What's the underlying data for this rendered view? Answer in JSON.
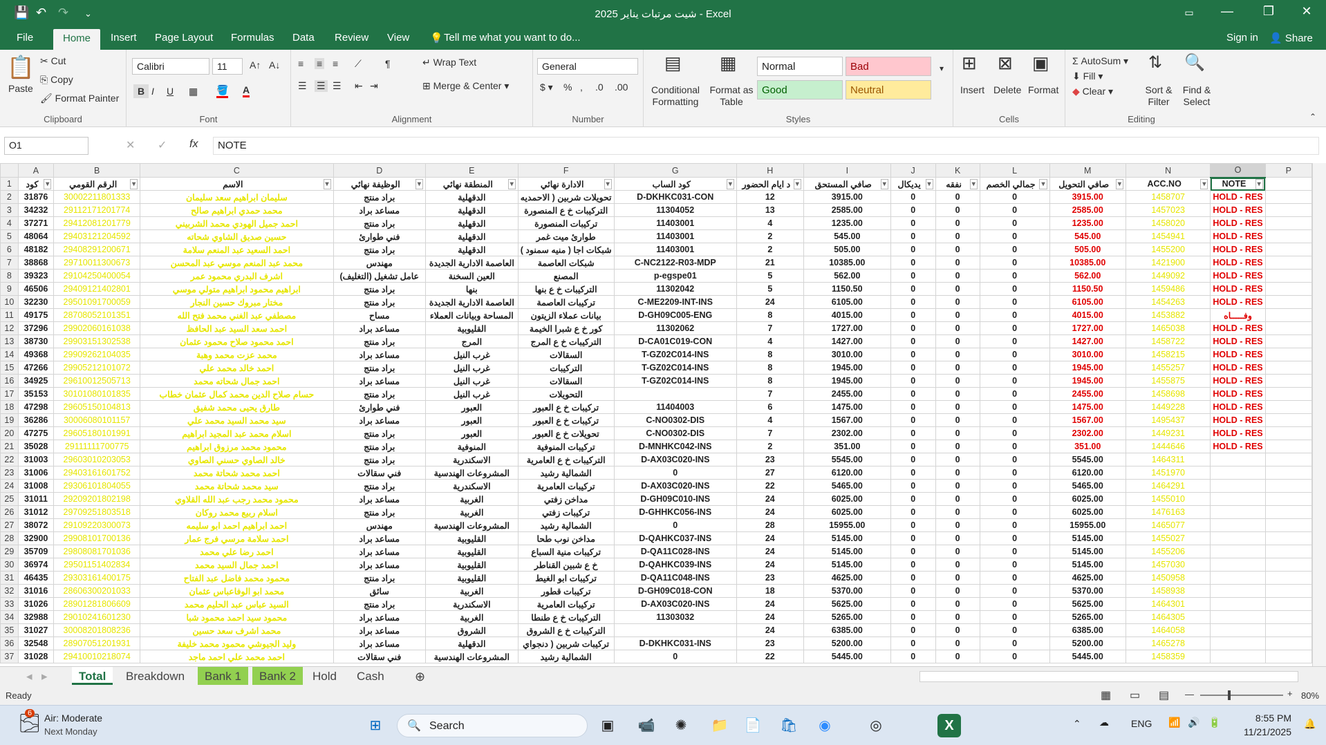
{
  "title": "شيت مرتبات يناير 2025 - Excel",
  "menu": {
    "file": "File",
    "tabs": [
      "Home",
      "Insert",
      "Page Layout",
      "Formulas",
      "Data",
      "Review",
      "View"
    ],
    "tell": "Tell me what you want to do...",
    "signin": "Sign in",
    "share": "Share"
  },
  "ribbon": {
    "clipboard": {
      "paste": "Paste",
      "cut": "Cut",
      "copy": "Copy",
      "painter": "Format Painter",
      "label": "Clipboard"
    },
    "font": {
      "name": "Calibri",
      "size": "11",
      "label": "Font"
    },
    "alignment": {
      "wrap": "Wrap Text",
      "merge": "Merge & Center",
      "label": "Alignment"
    },
    "number": {
      "format": "General",
      "label": "Number"
    },
    "styles": {
      "cond": "Conditional Formatting",
      "table": "Format as Table",
      "normal": "Normal",
      "bad": "Bad",
      "good": "Good",
      "neutral": "Neutral",
      "label": "Styles"
    },
    "cells": {
      "insert": "Insert",
      "delete": "Delete",
      "format": "Format",
      "label": "Cells"
    },
    "editing": {
      "autosum": "AutoSum",
      "fill": "Fill",
      "clear": "Clear",
      "sort": "Sort & Filter",
      "find": "Find & Select",
      "label": "Editing"
    }
  },
  "formula": {
    "namebox": "O1",
    "fx": "fx",
    "value": "NOTE"
  },
  "columns": [
    "A",
    "B",
    "C",
    "D",
    "E",
    "F",
    "G",
    "H",
    "I",
    "J",
    "K",
    "L",
    "M",
    "N",
    "O",
    "P"
  ],
  "headers": [
    "كود",
    "الرقم القومي",
    "الاسم",
    "الوظيفة نهائي",
    "المنطقة نهائي",
    "الادارة نهائي",
    "كود الساب",
    "د ايام الحضور",
    "صافي المستحق",
    "يديكال",
    "نفقه",
    "جمالي الخصم",
    "صافي التحويل",
    "ACC.NO",
    "NOTE"
  ],
  "rows": [
    [
      "31876",
      "30002211801333",
      "سليمان ابراهيم سعد سليمان",
      "براد منتج",
      "الدقهلية",
      "تحويلات شربين ( الاحمديه",
      "D-DKHKC031-CON",
      "12",
      "3915.00",
      "0",
      "0",
      "0",
      "3915.00",
      "1458707",
      "HOLD - RES"
    ],
    [
      "34232",
      "29112171201774",
      "محمد حمدي ابراهيم صالح",
      "مساعد براد",
      "الدقهلية",
      "التركيبات خ ع المنصورة",
      "11304052",
      "13",
      "2585.00",
      "0",
      "0",
      "0",
      "2585.00",
      "1457023",
      "HOLD - RES"
    ],
    [
      "37271",
      "29412081201779",
      "احمد جميل الهودي محمد الشربيني",
      "براد منتج",
      "الدقهلية",
      "تركيبات المنصورة",
      "11403001",
      "4",
      "1235.00",
      "0",
      "0",
      "0",
      "1235.00",
      "1458020",
      "HOLD - RES"
    ],
    [
      "48064",
      "29403121204592",
      "حسين صديق الشاوي شحاته",
      "فني طوارئ",
      "الدقهلية",
      "طوارئ ميت غمر",
      "11403001",
      "2",
      "545.00",
      "0",
      "0",
      "0",
      "545.00",
      "1454941",
      "HOLD - RES"
    ],
    [
      "48182",
      "29408291200671",
      "احمد السعيد عبد المنعم سلامة",
      "براد منتج",
      "الدقهلية",
      "شبكات اجا ( منيه سمنود )",
      "11403001",
      "2",
      "505.00",
      "0",
      "0",
      "0",
      "505.00",
      "1455200",
      "HOLD - RES"
    ],
    [
      "38868",
      "29710011300673",
      "محمد عبد المنعم موسي عبد المحسن",
      "مهندس",
      "العاصمة الادارية الجديدة",
      "شبكات العاصمة",
      "C-NC2122-R03-MDP",
      "21",
      "10385.00",
      "0",
      "0",
      "0",
      "10385.00",
      "1421900",
      "HOLD - RES"
    ],
    [
      "39323",
      "29104250400054",
      "اشرف البدري محمود عمر",
      "عامل تشغيل (التغليف)",
      "العين السخنة",
      "المصنع",
      "p-egspe01",
      "5",
      "562.00",
      "0",
      "0",
      "0",
      "562.00",
      "1449092",
      "HOLD - RES"
    ],
    [
      "46506",
      "29409121402801",
      "ابراهيم محمود ابراهيم متولي موسي",
      "براد منتج",
      "بنها",
      "التركيبات خ ع بنها",
      "11302042",
      "5",
      "1150.50",
      "0",
      "0",
      "0",
      "1150.50",
      "1459486",
      "HOLD - RES"
    ],
    [
      "32230",
      "29501091700059",
      "مختار مبروك حسين النجار",
      "براد منتج",
      "العاصمة الادارية الجديدة",
      "تركيبات العاصمة",
      "C-ME2209-INT-INS",
      "24",
      "6105.00",
      "0",
      "0",
      "0",
      "6105.00",
      "1454263",
      "HOLD - RES"
    ],
    [
      "49175",
      "28708052101351",
      "مصطفي عبد الغني محمد فتح الله",
      "مساح",
      "المساحة وبيانات العملاء",
      "بيانات عملاء الزيتون",
      "D-GH09C005-ENG",
      "8",
      "4015.00",
      "0",
      "0",
      "0",
      "4015.00",
      "1453882",
      "وفـــــاه"
    ],
    [
      "37296",
      "29902060161038",
      "احمد سعد السيد عبد الحافظ",
      "مساعد براد",
      "القليوبية",
      "كور خ ع شبرا الخيمة",
      "11302062",
      "7",
      "1727.00",
      "0",
      "0",
      "0",
      "1727.00",
      "1465038",
      "HOLD - RES"
    ],
    [
      "38730",
      "29903151302538",
      "احمد محمود صلاح محمود عثمان",
      "براد منتج",
      "المرج",
      "التركيبات خ ع المرج",
      "D-CA01C019-CON",
      "4",
      "1427.00",
      "0",
      "0",
      "0",
      "1427.00",
      "1458722",
      "HOLD - RES"
    ],
    [
      "49368",
      "29909262104035",
      "محمد عزت محمد وهبة",
      "مساعد براد",
      "غرب النيل",
      "السقالات",
      "T-GZ02C014-INS",
      "8",
      "3010.00",
      "0",
      "0",
      "0",
      "3010.00",
      "1458215",
      "HOLD - RES"
    ],
    [
      "47266",
      "29905212101072",
      "احمد خالد محمد علي",
      "براد منتج",
      "غرب النيل",
      "التركيبات",
      "T-GZ02C014-INS",
      "8",
      "1945.00",
      "0",
      "0",
      "0",
      "1945.00",
      "1455257",
      "HOLD - RES"
    ],
    [
      "34925",
      "29610012505713",
      "احمد جمال شحاته محمد",
      "مساعد براد",
      "غرب النيل",
      "السقالات",
      "T-GZ02C014-INS",
      "8",
      "1945.00",
      "0",
      "0",
      "0",
      "1945.00",
      "1455875",
      "HOLD - RES"
    ],
    [
      "35153",
      "30101080101835",
      "حسام صلاح الدين محمد كمال عثمان خطاب",
      "براد منتج",
      "غرب النيل",
      "التحويلات",
      "",
      "7",
      "2455.00",
      "0",
      "0",
      "0",
      "2455.00",
      "1458698",
      "HOLD - RES"
    ],
    [
      "47298",
      "29605150104813",
      "طارق يحيى محمد شفيق",
      "فني طوارئ",
      "العبور",
      "تركيبات خ ع العبور",
      "11404003",
      "6",
      "1475.00",
      "0",
      "0",
      "0",
      "1475.00",
      "1449228",
      "HOLD - RES"
    ],
    [
      "36286",
      "30006080101157",
      "سيد محمد السيد محمد علي",
      "مساعد براد",
      "العبور",
      "تركيبات خ ع العبور",
      "C-NO0302-DIS",
      "4",
      "1567.00",
      "0",
      "0",
      "0",
      "1567.00",
      "1495437",
      "HOLD - RES"
    ],
    [
      "47275",
      "29605180101991",
      "اسلام محمد عبد المجيد ابراهيم",
      "براد منتج",
      "العبور",
      "تحويلات خ ع العبور",
      "C-NO0302-DIS",
      "7",
      "2302.00",
      "0",
      "0",
      "0",
      "2302.00",
      "1449231",
      "HOLD - RES"
    ],
    [
      "35028",
      "29111111700775",
      "محمود محمد مرزوق ابراهيم",
      "براد منتج",
      "المنوفية",
      "تركيبات المنوفية",
      "D-MNHKC042-INS",
      "2",
      "351.00",
      "0",
      "0",
      "0",
      "351.00",
      "1444646",
      "HOLD - RES"
    ],
    [
      "31003",
      "29603010203053",
      "خالد الصاوي حسني الصاوي",
      "براد منتج",
      "الاسكندرية",
      "التركيبات خ ع العامرية",
      "D-AX03C020-INS",
      "23",
      "5545.00",
      "0",
      "0",
      "0",
      "5545.00",
      "1464311",
      ""
    ],
    [
      "31006",
      "29403161601752",
      "احمد محمد شحاتة محمد",
      "فني سقالات",
      "المشروعات الهندسية",
      "الشمالية رشيد",
      "0",
      "27",
      "6120.00",
      "0",
      "0",
      "0",
      "6120.00",
      "1451970",
      ""
    ],
    [
      "31008",
      "29306101804055",
      "سيد محمد شحاتة محمد",
      "براد منتج",
      "الاسكندرية",
      "تركيبات العامرية",
      "D-AX03C020-INS",
      "22",
      "5465.00",
      "0",
      "0",
      "0",
      "5465.00",
      "1464291",
      ""
    ],
    [
      "31011",
      "29209201802198",
      "محمود محمد رجب عبد الله القلاوي",
      "مساعد براد",
      "الغربية",
      "مداخن زفتي",
      "D-GH09C010-INS",
      "24",
      "6025.00",
      "0",
      "0",
      "0",
      "6025.00",
      "1455010",
      ""
    ],
    [
      "31012",
      "29709251803518",
      "اسلام ربيع محمد روكان",
      "براد منتج",
      "الغربية",
      "تركيبات زفتي",
      "D-GHHKC056-INS",
      "24",
      "6025.00",
      "0",
      "0",
      "0",
      "6025.00",
      "1476163",
      ""
    ],
    [
      "38072",
      "29109220300073",
      "احمد ابراهيم احمد ابو سليمه",
      "مهندس",
      "المشروعات الهندسية",
      "الشمالية رشيد",
      "0",
      "28",
      "15955.00",
      "0",
      "0",
      "0",
      "15955.00",
      "1465077",
      ""
    ],
    [
      "32900",
      "29908101700136",
      "احمد سلامة مرسي فرج عمار",
      "مساعد براد",
      "القليوبية",
      "مداخن نوب طحا",
      "D-QAHKC037-INS",
      "24",
      "5145.00",
      "0",
      "0",
      "0",
      "5145.00",
      "1455027",
      ""
    ],
    [
      "35709",
      "29808081701036",
      "احمد رضا علي محمد",
      "مساعد براد",
      "القليوبية",
      "تركيبات منية السباع",
      "D-QA11C028-INS",
      "24",
      "5145.00",
      "0",
      "0",
      "0",
      "5145.00",
      "1455206",
      ""
    ],
    [
      "36974",
      "29501151402834",
      "احمد جمال السيد محمد",
      "مساعد براد",
      "القليوبية",
      "خ ع شبين القناطر",
      "D-QAHKC039-INS",
      "24",
      "5145.00",
      "0",
      "0",
      "0",
      "5145.00",
      "1457030",
      ""
    ],
    [
      "46435",
      "29303161400175",
      "محمود محمد فاضل عبد الفتاح",
      "براد منتج",
      "القليوبية",
      "تركيبات ابو الغيط",
      "D-QA11C048-INS",
      "23",
      "4625.00",
      "0",
      "0",
      "0",
      "4625.00",
      "1450958",
      ""
    ],
    [
      "31016",
      "28606300201033",
      "محمد ابو الوفاعباس عثمان",
      "سائق",
      "الغربية",
      "تركيبات قطور",
      "D-GH09C018-CON",
      "18",
      "5370.00",
      "0",
      "0",
      "0",
      "5370.00",
      "1458938",
      ""
    ],
    [
      "31026",
      "28901281806609",
      "السيد عباس عبد الحليم محمد",
      "براد منتج",
      "الاسكندرية",
      "تركيبات العامرية",
      "D-AX03C020-INS",
      "24",
      "5625.00",
      "0",
      "0",
      "0",
      "5625.00",
      "1464301",
      ""
    ],
    [
      "32988",
      "29010241601230",
      "محمود سيد احمد محمود شبا",
      "مساعد براد",
      "الغربية",
      "التركيبات خ ع طنطا",
      "11303032",
      "24",
      "5265.00",
      "0",
      "0",
      "0",
      "5265.00",
      "1464305",
      ""
    ],
    [
      "31027",
      "30008201808236",
      "محمد اشرف سعد حسين",
      "مساعد براد",
      "الشروق",
      "التركيبات خ ع الشروق",
      "",
      "24",
      "6385.00",
      "0",
      "0",
      "0",
      "6385.00",
      "1464058",
      ""
    ],
    [
      "32548",
      "28907051201931",
      "وليد الجيوشي محمود محمد خليفة",
      "مساعد براد",
      "الدقهلية",
      "تركيبات شربين ( دنجواي",
      "D-DKHKC031-INS",
      "23",
      "5200.00",
      "0",
      "0",
      "0",
      "5200.00",
      "1465278",
      ""
    ],
    [
      "31028",
      "29410010218074",
      "احمد محمد علي احمد ماجد",
      "فني سقالات",
      "المشروعات الهندسية",
      "الشمالية رشيد",
      "0",
      "22",
      "5445.00",
      "0",
      "0",
      "0",
      "5445.00",
      "1458359",
      ""
    ]
  ],
  "sheets": [
    "Total",
    "Breakdown",
    "Bank 1",
    "Bank 2",
    "Hold",
    "Cash"
  ],
  "status": {
    "ready": "Ready",
    "zoom": "80%"
  },
  "taskbar": {
    "weather": "Air: Moderate",
    "weather_sub": "Next Monday",
    "weather_badge": "6",
    "search": "Search",
    "lang": "ENG",
    "time": "8:55 PM",
    "date": "11/21/2025"
  },
  "colors": {
    "excel_green": "#217346",
    "yellow_text": "#e6e600",
    "red_text": "#e00000"
  }
}
